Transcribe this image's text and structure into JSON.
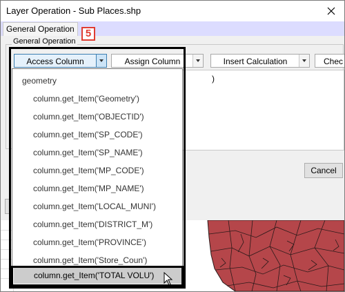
{
  "window": {
    "title": "Layer Operation - Sub Places.shp"
  },
  "tabs": [
    {
      "label": "General Operation"
    }
  ],
  "group": {
    "label": "General Operation"
  },
  "toolbar": {
    "access_column": "Access Column",
    "assign_column": "Assign Column",
    "insert_calculation": "Insert Calculation",
    "check_partial": "Chec"
  },
  "editor": {
    "paren": ")"
  },
  "buttons": {
    "cancel": "Cancel"
  },
  "dropdown": {
    "items": [
      "geometry",
      "column.get_Item('Geometry')",
      "column.get_Item('OBJECTID')",
      "column.get_Item('SP_CODE')",
      "column.get_Item('SP_NAME')",
      "column.get_Item('MP_CODE')",
      "column.get_Item('MP_NAME')",
      "column.get_Item('LOCAL_MUNI')",
      "column.get_Item('DISTRICT_M')",
      "column.get_Item('PROVINCE')",
      "column.get_Item('Store_Coun')"
    ],
    "selected": "column.get_Item('TOTAL VOLU')"
  },
  "annotation": {
    "step": "5",
    "color": "#e03c31"
  },
  "map": {
    "fill": "#b5464a",
    "stroke": "#2a1a1a"
  },
  "icons": {
    "close": "close-icon",
    "dropdown_arrow": "chevron-down-icon",
    "cursor": "mouse-pointer-icon"
  }
}
